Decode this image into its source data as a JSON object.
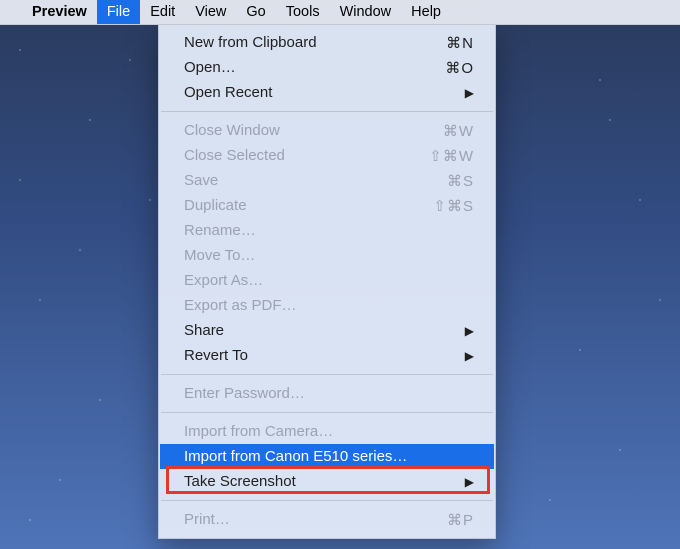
{
  "menubar": {
    "app": "Preview",
    "items": [
      "File",
      "Edit",
      "View",
      "Go",
      "Tools",
      "Window",
      "Help"
    ],
    "selected_index": 0
  },
  "menu": {
    "groups": [
      [
        {
          "label": "New from Clipboard",
          "shortcut": "⌘N",
          "enabled": true
        },
        {
          "label": "Open…",
          "shortcut": "⌘O",
          "enabled": true
        },
        {
          "label": "Open Recent",
          "submenu": true,
          "enabled": true
        }
      ],
      [
        {
          "label": "Close Window",
          "shortcut": "⌘W",
          "enabled": false
        },
        {
          "label": "Close Selected",
          "shortcut": "⇧⌘W",
          "enabled": false
        },
        {
          "label": "Save",
          "shortcut": "⌘S",
          "enabled": false
        },
        {
          "label": "Duplicate",
          "shortcut": "⇧⌘S",
          "enabled": false
        },
        {
          "label": "Rename…",
          "enabled": false
        },
        {
          "label": "Move To…",
          "enabled": false
        },
        {
          "label": "Export As…",
          "enabled": false
        },
        {
          "label": "Export as PDF…",
          "enabled": false
        },
        {
          "label": "Share",
          "submenu": true,
          "enabled": true
        },
        {
          "label": "Revert To",
          "submenu": true,
          "enabled": true
        }
      ],
      [
        {
          "label": "Enter Password…",
          "enabled": false
        }
      ],
      [
        {
          "label": "Import from Camera…",
          "enabled": false
        },
        {
          "label": "Import from Canon E510 series…",
          "enabled": true,
          "highlight": true
        },
        {
          "label": "Take Screenshot",
          "submenu": true,
          "enabled": true
        }
      ],
      [
        {
          "label": "Print…",
          "shortcut": "⌘P",
          "enabled": false
        }
      ]
    ]
  }
}
